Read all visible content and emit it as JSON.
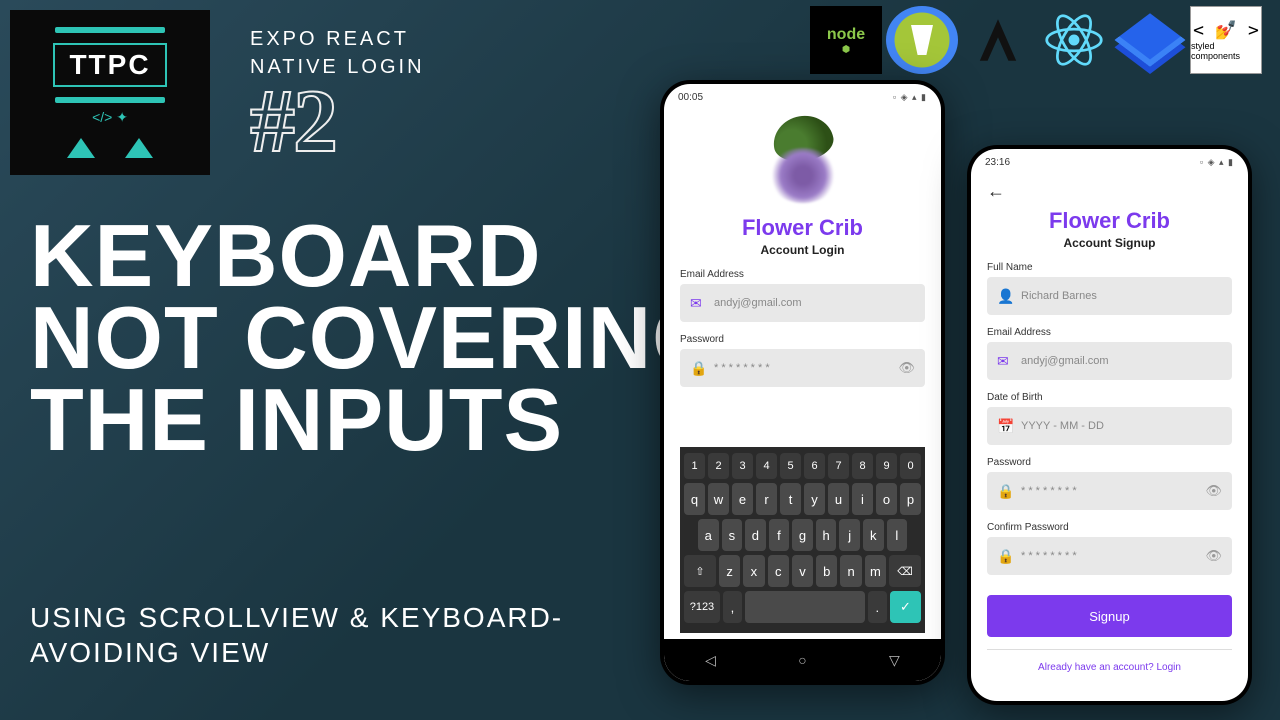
{
  "logo": {
    "text": "TTPC"
  },
  "subtitle": {
    "line1": "EXPO REACT",
    "line2": "NATIVE LOGIN"
  },
  "number": "#2",
  "headline": {
    "l1": "KEYBOARD",
    "l2": "NOT COVERING",
    "l3": "THE INPUTS"
  },
  "subhead": {
    "l1": "USING SCROLLVIEW & KEYBOARD-",
    "l2": "AVOIDING VIEW"
  },
  "tech": {
    "node": "node",
    "styled_tag": "< 💅 >",
    "styled_label": "styled components"
  },
  "phone1": {
    "time": "00:05",
    "app_title": "Flower Crib",
    "app_sub": "Account Login",
    "email_label": "Email Address",
    "email_value": "andyj@gmail.com",
    "password_label": "Password",
    "password_value": "* * * * * * * *",
    "kb": {
      "nums": [
        "1",
        "2",
        "3",
        "4",
        "5",
        "6",
        "7",
        "8",
        "9",
        "0"
      ],
      "r1": [
        "q",
        "w",
        "e",
        "r",
        "t",
        "y",
        "u",
        "i",
        "o",
        "p"
      ],
      "r2": [
        "a",
        "s",
        "d",
        "f",
        "g",
        "h",
        "j",
        "k",
        "l"
      ],
      "r3": [
        "z",
        "x",
        "c",
        "v",
        "b",
        "n",
        "m"
      ],
      "shift": "⇧",
      "back": "⌫",
      "sym": "?123",
      "lang": ",",
      "space": "",
      "dot": ".",
      "action": "✓"
    }
  },
  "phone2": {
    "time": "23:16",
    "app_title": "Flower Crib",
    "app_sub": "Account Signup",
    "name_label": "Full Name",
    "name_value": "Richard Barnes",
    "email_label": "Email Address",
    "email_value": "andyj@gmail.com",
    "dob_label": "Date of Birth",
    "dob_value": "YYYY - MM - DD",
    "password_label": "Password",
    "password_value": "* * * * * * * *",
    "confirm_label": "Confirm Password",
    "confirm_value": "* * * * * * * *",
    "signup_btn": "Signup",
    "already": "Already have an account? ",
    "login_link": "Login"
  }
}
